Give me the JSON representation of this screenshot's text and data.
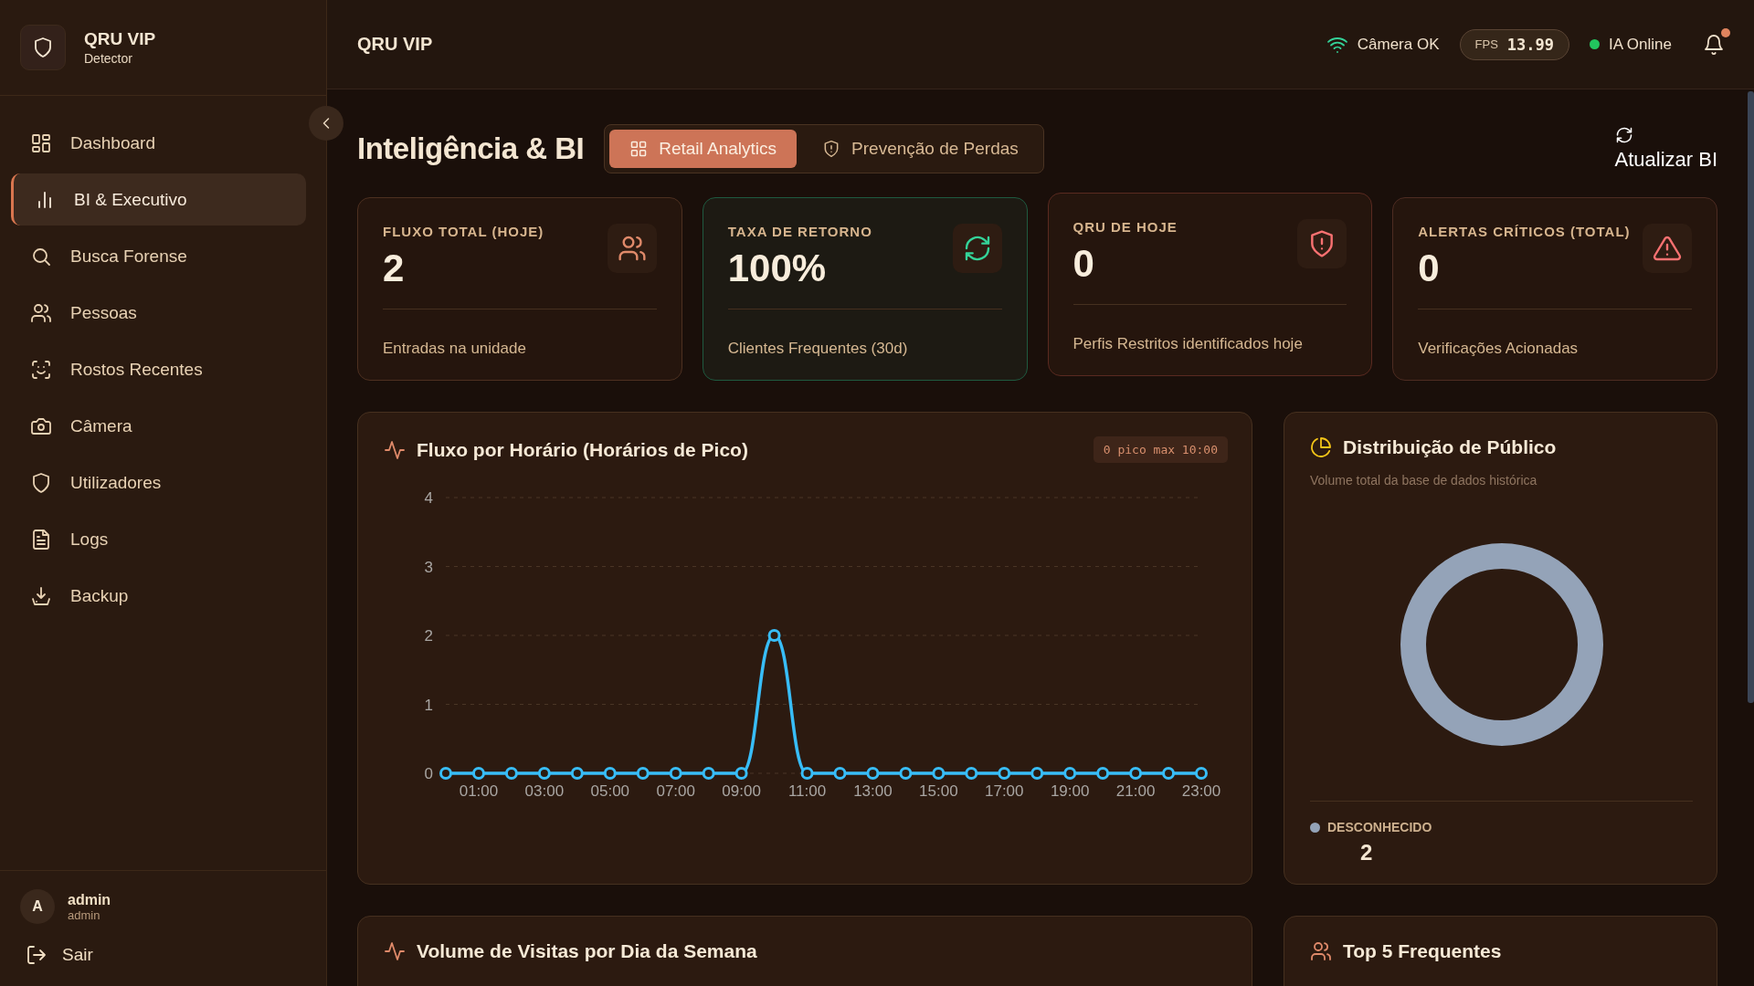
{
  "brand": {
    "title": "QRU VIP",
    "subtitle": "Detector"
  },
  "sidebar": {
    "items": [
      {
        "label": "Dashboard",
        "selected": false
      },
      {
        "label": "BI & Executivo",
        "selected": true
      },
      {
        "label": "Busca Forense",
        "selected": false
      },
      {
        "label": "Pessoas",
        "selected": false
      },
      {
        "label": "Rostos Recentes",
        "selected": false
      },
      {
        "label": "Câmera",
        "selected": false
      },
      {
        "label": "Utilizadores",
        "selected": false
      },
      {
        "label": "Logs",
        "selected": false
      },
      {
        "label": "Backup",
        "selected": false
      }
    ],
    "user": {
      "avatar": "A",
      "name": "admin",
      "role": "admin"
    },
    "logout": "Sair"
  },
  "header": {
    "title": "QRU VIP",
    "camera_status": "Câmera OK",
    "fps_label": "FPS",
    "fps_value": "13.99",
    "ai_status": "IA Online",
    "ai_online": true,
    "notifications_unread": true
  },
  "page": {
    "title": "Inteligência & BI",
    "refresh": "Atualizar BI"
  },
  "tabs": [
    {
      "label": "Retail Analytics",
      "selected": true
    },
    {
      "label": "Prevenção de Perdas",
      "selected": false
    }
  ],
  "stats": [
    {
      "kind": "info",
      "label": "FLUXO TOTAL (HOJE)",
      "value": "2",
      "footer": "Entradas na unidade"
    },
    {
      "kind": "success",
      "label": "TAXA DE RETORNO",
      "value": "100%",
      "footer": "Clientes Frequentes (30d)"
    },
    {
      "kind": "danger",
      "label": "QRU DE HOJE",
      "value": "0",
      "footer": "Perfis Restritos identificados hoje"
    },
    {
      "kind": "warning",
      "label": "ALERTAS CRÍTICOS (TOTAL)",
      "value": "0",
      "footer": "Verificações Acionadas"
    }
  ],
  "hourly": {
    "badge": "0 pico max 10:00",
    "chart_data": {
      "type": "line",
      "title": "Fluxo por Horário (Horários de Pico)",
      "x": [
        0,
        1,
        2,
        3,
        4,
        5,
        6,
        7,
        8,
        9,
        10,
        11,
        12,
        13,
        14,
        15,
        16,
        17,
        18,
        19,
        20,
        21,
        22,
        23
      ],
      "series": [
        {
          "color": "#38bdf8",
          "values": [
            0,
            0,
            0,
            0,
            0,
            0,
            0,
            0,
            0,
            0,
            2,
            0,
            0,
            0,
            0,
            0,
            0,
            0,
            0,
            0,
            0,
            0,
            0,
            0
          ]
        }
      ],
      "xticks": [
        {
          "value": 1,
          "label": "01:00"
        },
        {
          "value": 3,
          "label": "03:00"
        },
        {
          "value": 5,
          "label": "05:00"
        },
        {
          "value": 7,
          "label": "07:00"
        },
        {
          "value": 9,
          "label": "09:00"
        },
        {
          "value": 11,
          "label": "11:00"
        },
        {
          "value": 13,
          "label": "13:00"
        },
        {
          "value": 15,
          "label": "15:00"
        },
        {
          "value": 17,
          "label": "17:00"
        },
        {
          "value": 19,
          "label": "19:00"
        },
        {
          "value": 21,
          "label": "21:00"
        },
        {
          "value": 23,
          "label": "23:00"
        }
      ],
      "xlim": [
        0,
        23
      ],
      "ylim": [
        0,
        4
      ],
      "yticks": [
        0,
        1,
        2,
        3,
        4
      ],
      "grid": true,
      "marker": "circle"
    }
  },
  "distribution": {
    "subtitle": "Volume total da base de dados histórica",
    "chart_data": {
      "type": "pie",
      "title": "Distribuição de Público",
      "categories": [
        "DESCONHECIDO"
      ],
      "series": [
        {
          "color": "#94a3b8",
          "values": [
            100
          ]
        }
      ]
    },
    "legend_values": [
      "2"
    ]
  },
  "weekly": {
    "title": "Volume de Visitas por Dia da Semana"
  },
  "top": {
    "title": "Top 5 Frequentes"
  }
}
